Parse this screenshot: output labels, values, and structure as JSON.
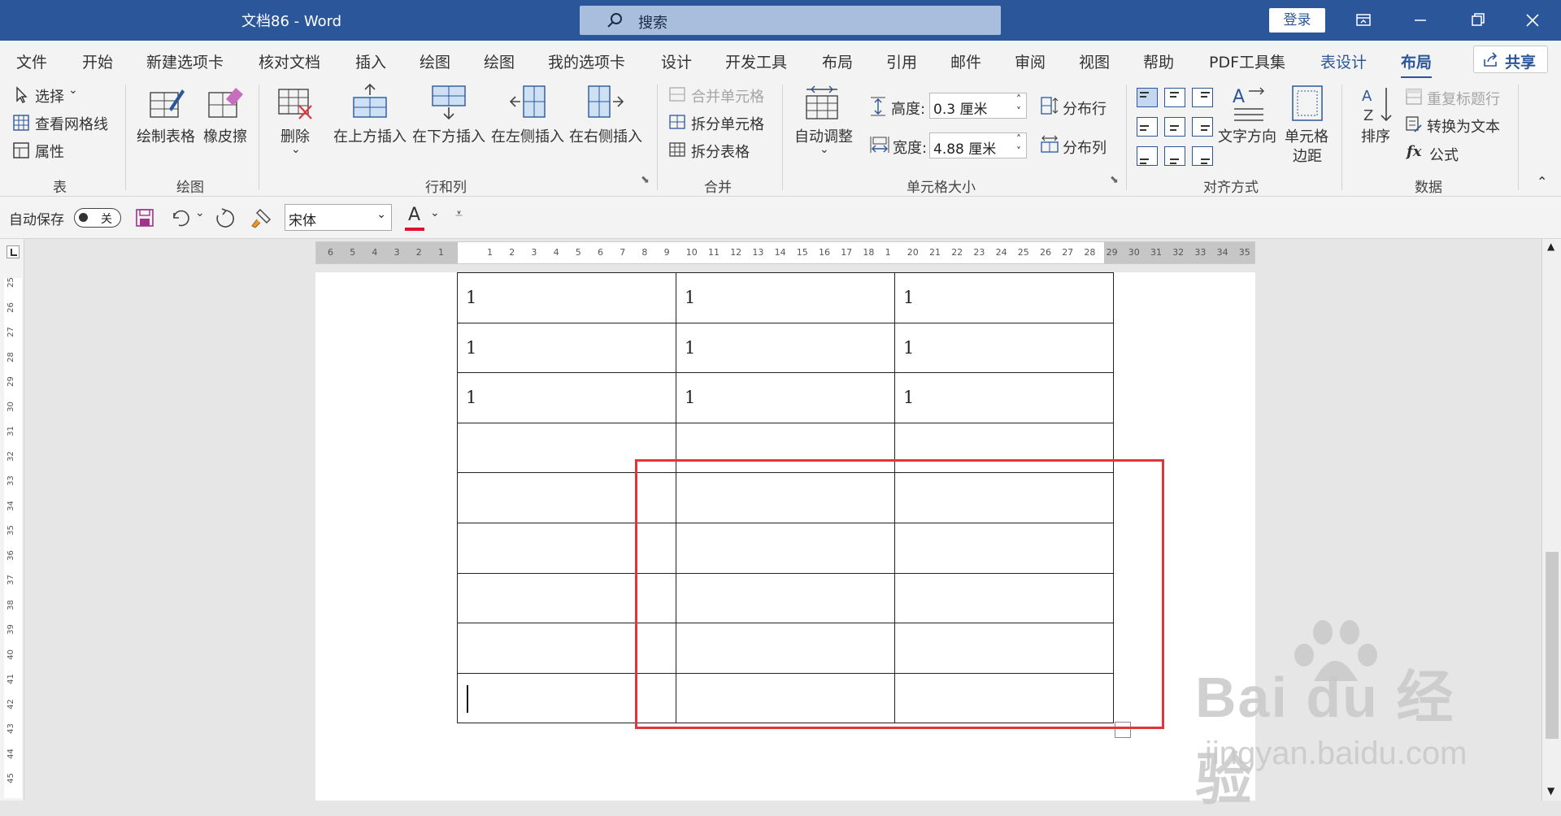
{
  "titlebar": {
    "title": "文档86  -  Word",
    "search": "搜索",
    "login": "登录",
    "minimize": "—",
    "maximize": "❐",
    "close": "✕"
  },
  "tabs": [
    "文件",
    "开始",
    "新建选项卡",
    "核对文档",
    "插入",
    "绘图",
    "绘图",
    "我的选项卡",
    "设计",
    "开发工具",
    "布局",
    "引用",
    "邮件",
    "审阅",
    "视图",
    "帮助",
    "PDF工具集",
    "表设计",
    "布局"
  ],
  "share": "共享",
  "ribbon": {
    "table_group": {
      "select": "选择",
      "gridlines": "查看网格线",
      "properties": "属性",
      "label": "表"
    },
    "draw_group": {
      "draw_table": "绘制表格",
      "eraser": "橡皮擦",
      "label": "绘图"
    },
    "rows_cols": {
      "delete": "删除",
      "insert_above": "在上方插入",
      "insert_below": "在下方插入",
      "insert_left": "在左侧插入",
      "insert_right": "在右侧插入",
      "label": "行和列"
    },
    "merge": {
      "merge_cells": "合并单元格",
      "split_cells": "拆分单元格",
      "split_table": "拆分表格",
      "label": "合并"
    },
    "cell_size": {
      "autofit": "自动调整",
      "height_label": "高度:",
      "height_value": "0.3 厘米",
      "width_label": "宽度:",
      "width_value": "4.88 厘米",
      "distribute_rows": "分布行",
      "distribute_cols": "分布列",
      "label": "单元格大小"
    },
    "alignment": {
      "text_direction": "文字方向",
      "cell_margins_1": "单元格",
      "cell_margins_2": "边距",
      "label": "对齐方式"
    },
    "data": {
      "sort": "排序",
      "repeat_header": "重复标题行",
      "convert_text": "转换为文本",
      "formula": "公式",
      "label": "数据"
    }
  },
  "qat": {
    "autosave": "自动保存",
    "toggle": "关",
    "font": "宋体",
    "font_color_letter": "A"
  },
  "ruler": {
    "left": [
      "6",
      "5",
      "4",
      "3",
      "2",
      "1"
    ],
    "right": [
      "1",
      "2",
      "3",
      "4",
      "5",
      "6",
      "7",
      "8",
      "9",
      "10",
      "11",
      "12",
      "13",
      "14",
      "15",
      "16",
      "17",
      "18",
      "1",
      "20",
      "21",
      "22",
      "23",
      "24",
      "25",
      "26",
      "27",
      "28",
      "29",
      "30",
      "31",
      "32",
      "33",
      "34",
      "35"
    ],
    "vertical": [
      "25",
      "26",
      "27",
      "28",
      "29",
      "30",
      "31",
      "32",
      "33",
      "34",
      "35",
      "36",
      "37",
      "38",
      "39",
      "40",
      "41",
      "42",
      "43",
      "44",
      "45"
    ]
  },
  "table": {
    "rows": [
      [
        "1",
        "1",
        "1"
      ],
      [
        "1",
        "1",
        "1"
      ],
      [
        "1",
        "1",
        "1"
      ],
      [
        "",
        "",
        ""
      ],
      [
        "",
        "",
        ""
      ],
      [
        "",
        "",
        ""
      ],
      [
        "",
        "",
        ""
      ],
      [
        "",
        "",
        ""
      ],
      [
        "",
        "",
        ""
      ]
    ]
  },
  "watermark": {
    "line1": "Bai du 经验",
    "line2": "jingyan.baidu.com"
  },
  "colors": {
    "brand": "#2b579a",
    "highlight": "#e0353b"
  }
}
